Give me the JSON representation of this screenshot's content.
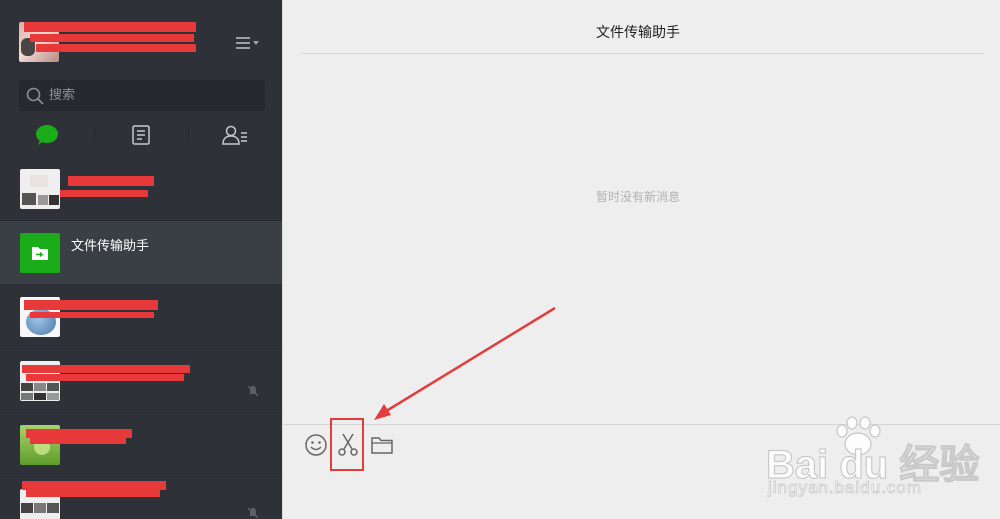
{
  "search": {
    "placeholder": "搜索"
  },
  "nav_tabs": [
    {
      "icon": "chat-bubble-icon",
      "active": true
    },
    {
      "icon": "article-icon",
      "active": false
    },
    {
      "icon": "contacts-icon",
      "active": false
    }
  ],
  "conversations": [
    {
      "name": "",
      "redacted": true,
      "muted": false
    },
    {
      "name": "文件传输助手",
      "redacted": false,
      "muted": false,
      "active": true
    },
    {
      "name": "",
      "redacted": true,
      "muted": false
    },
    {
      "name": "",
      "redacted": true,
      "muted": true
    },
    {
      "name": "",
      "redacted": true,
      "muted": false
    },
    {
      "name": "",
      "redacted": true,
      "muted": true
    }
  ],
  "chat": {
    "title": "文件传输助手",
    "empty_message": "暂时没有新消息"
  },
  "toolbar": [
    {
      "icon": "emoji-icon"
    },
    {
      "icon": "scissors-icon"
    },
    {
      "icon": "folder-icon"
    }
  ],
  "watermark": {
    "brand": "Bai du 经验",
    "site": "jingyan.baidu.com"
  },
  "colors": {
    "sidebar_bg": "#2e3238",
    "active_item_bg": "#3a3f45",
    "main_bg": "#eeeeee",
    "accent_green": "#1aad19",
    "annotation_red": "#e23c3c"
  }
}
